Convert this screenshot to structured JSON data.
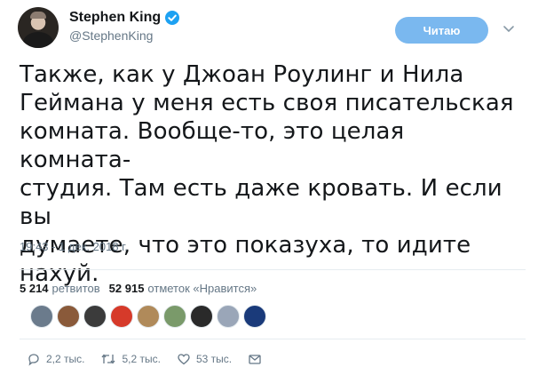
{
  "author": {
    "name": "Stephen King",
    "handle": "@StephenKing"
  },
  "follow_button": {
    "label": "Читаю"
  },
  "tweet": {
    "lines": [
      "Также, как у Джоан Роулинг и Нила",
      "Геймана у меня есть своя писательская",
      "комната. Вообще-то, это целая комната-",
      "студия. Там есть даже кровать. И если вы",
      "думаете, что это показуха, то идите нахуй."
    ],
    "timestamp": "19:43 - 1 дек. 2018 г."
  },
  "stats": {
    "retweets_count": "5 214",
    "retweets_label": "ретвитов",
    "likes_count": "52 915",
    "likes_label": "отметок «Нравится»"
  },
  "likers": [
    {
      "color": "#6b7b8c"
    },
    {
      "color": "#8a5a3a"
    },
    {
      "color": "#3b3b3b"
    },
    {
      "color": "#d63a2a"
    },
    {
      "color": "#b08a5a"
    },
    {
      "color": "#7a9a6a"
    },
    {
      "color": "#2a2a2a"
    },
    {
      "color": "#9aa6b8"
    },
    {
      "color": "#1a3a7a"
    }
  ],
  "actions": {
    "replies": "2,2 тыс.",
    "retweets": "5,2 тыс.",
    "likes": "53 тыс."
  },
  "colors": {
    "accent": "#1da1f2",
    "follow_bg": "#7ab8ef",
    "secondary_text": "#657786"
  }
}
